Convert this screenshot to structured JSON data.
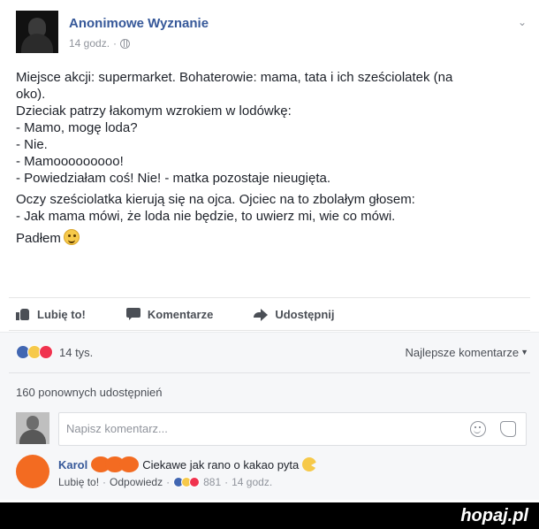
{
  "post": {
    "page_name": "Anonimowe Wyznanie",
    "time": "14 godz.",
    "meta_separator": "·",
    "menu_glyph": "⌄",
    "paragraphs": [
      [
        "Miejsce akcji: supermarket. Bohaterowie: mama, tata i ich sześciolatek (na",
        "oko).",
        "Dzieciak patrzy łakomym wzrokiem w lodówkę:",
        "- Mamo, mogę loda?",
        "- Nie.",
        "- Mamooooooooo!",
        "- Powiedziałam coś! Nie! - matka pozostaje nieugięta."
      ],
      [
        "Oczy sześciolatka kierują się na ojca. Ojciec na to zbolałym głosem:",
        "- Jak mama mówi, że loda nie będzie, to uwierz mi, wie co mówi."
      ]
    ],
    "closing": "Padłem"
  },
  "actions": {
    "like": "Lubię to!",
    "comment": "Komentarze",
    "share": "Udostępnij"
  },
  "reactions": {
    "count": "14 tys.",
    "sort_label": "Najlepsze komentarze",
    "sort_caret": "▼",
    "shares": "160 ponownych udostępnień",
    "colors": {
      "like": "#4267b2",
      "haha": "#f6c94a",
      "love": "#f0324e"
    }
  },
  "comment_box": {
    "placeholder": "Napisz komentarz..."
  },
  "comment": {
    "author": "Karol",
    "text": "Ciekawe jak rano o kakao pyta",
    "like_label": "Lubię to!",
    "reply_label": "Odpowiedz",
    "sep": "·",
    "reaction_count": "881",
    "time": "14 godz."
  },
  "footer": {
    "brand": "hopaj.pl"
  }
}
